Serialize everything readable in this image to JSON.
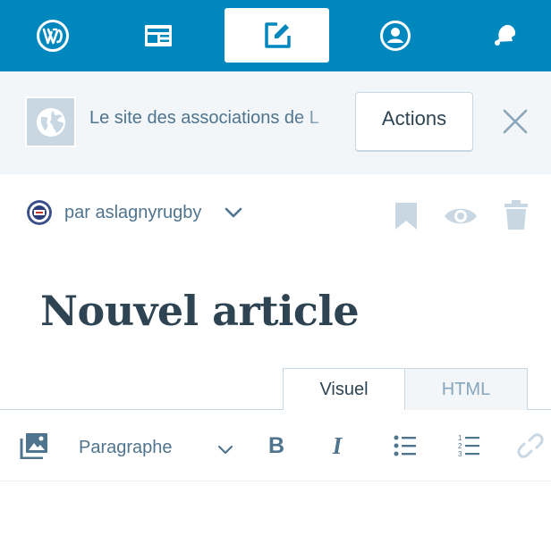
{
  "masterbar": {
    "items": [
      {
        "icon": "wordpress-logo-icon",
        "active": false
      },
      {
        "icon": "reader-icon",
        "active": false
      },
      {
        "icon": "write-post-icon",
        "active": true
      },
      {
        "icon": "profile-icon",
        "active": false
      },
      {
        "icon": "notifications-bell-icon",
        "active": false
      }
    ],
    "color": "#0087be"
  },
  "site": {
    "title": "Le site des associations de L",
    "actions_label": "Actions"
  },
  "post": {
    "author_label": "par aslagnyrugby",
    "title": "Nouvel article"
  },
  "editor": {
    "tabs": [
      {
        "label": "Visuel",
        "active": true
      },
      {
        "label": "HTML",
        "active": false
      }
    ],
    "toolbar": {
      "format_value": "Paragraphe",
      "bold_label": "B",
      "italic_label": "I"
    }
  },
  "colors": {
    "accent": "#0087be",
    "text_dark": "#2e4453",
    "text_muted": "#4f748e",
    "icon_light": "#c8d7e1"
  }
}
